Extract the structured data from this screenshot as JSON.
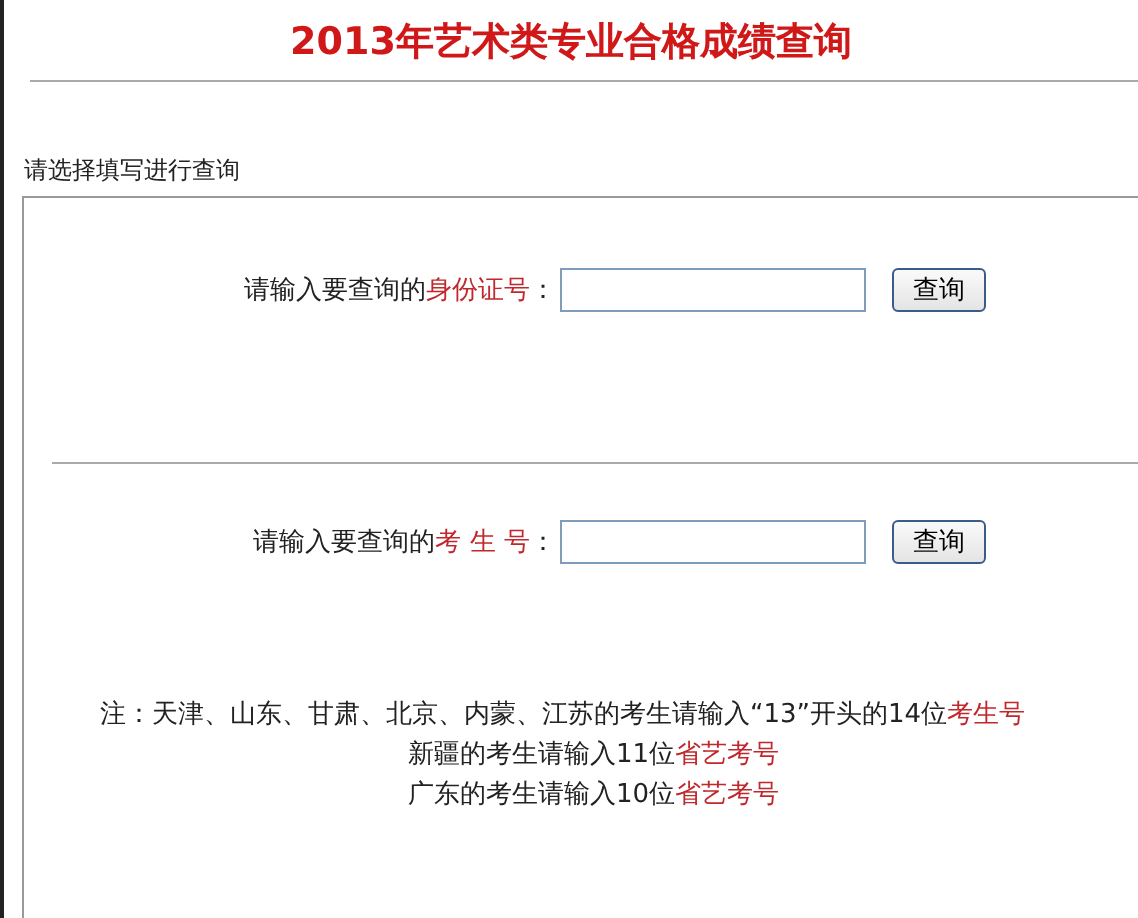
{
  "title": "2013年艺术类专业合格成绩查询",
  "instruction": "请选择填写进行查询",
  "queries": [
    {
      "label": [
        {
          "text": "请输入要查询的",
          "highlight": false
        },
        {
          "text": "身份证号",
          "highlight": true
        },
        {
          "text": "：",
          "highlight": false
        }
      ],
      "button": "查询"
    },
    {
      "label": [
        {
          "text": "请输入要查询的",
          "highlight": false
        },
        {
          "text": "考 生 号",
          "highlight": true
        },
        {
          "text": "：",
          "highlight": false
        }
      ],
      "button": "查询"
    }
  ],
  "notes": [
    {
      "parts": [
        {
          "text": "注：天津、山东、甘肃、北京、内蒙、江苏的考生请输入“13”开头的14位",
          "highlight": false
        },
        {
          "text": "考生号",
          "highlight": true
        }
      ]
    },
    {
      "parts": [
        {
          "text": "新疆的考生请输入11位",
          "highlight": false
        },
        {
          "text": "省艺考号",
          "highlight": true
        }
      ]
    },
    {
      "parts": [
        {
          "text": "广东的考生请输入10位",
          "highlight": false
        },
        {
          "text": "省艺考号",
          "highlight": true
        }
      ]
    }
  ]
}
